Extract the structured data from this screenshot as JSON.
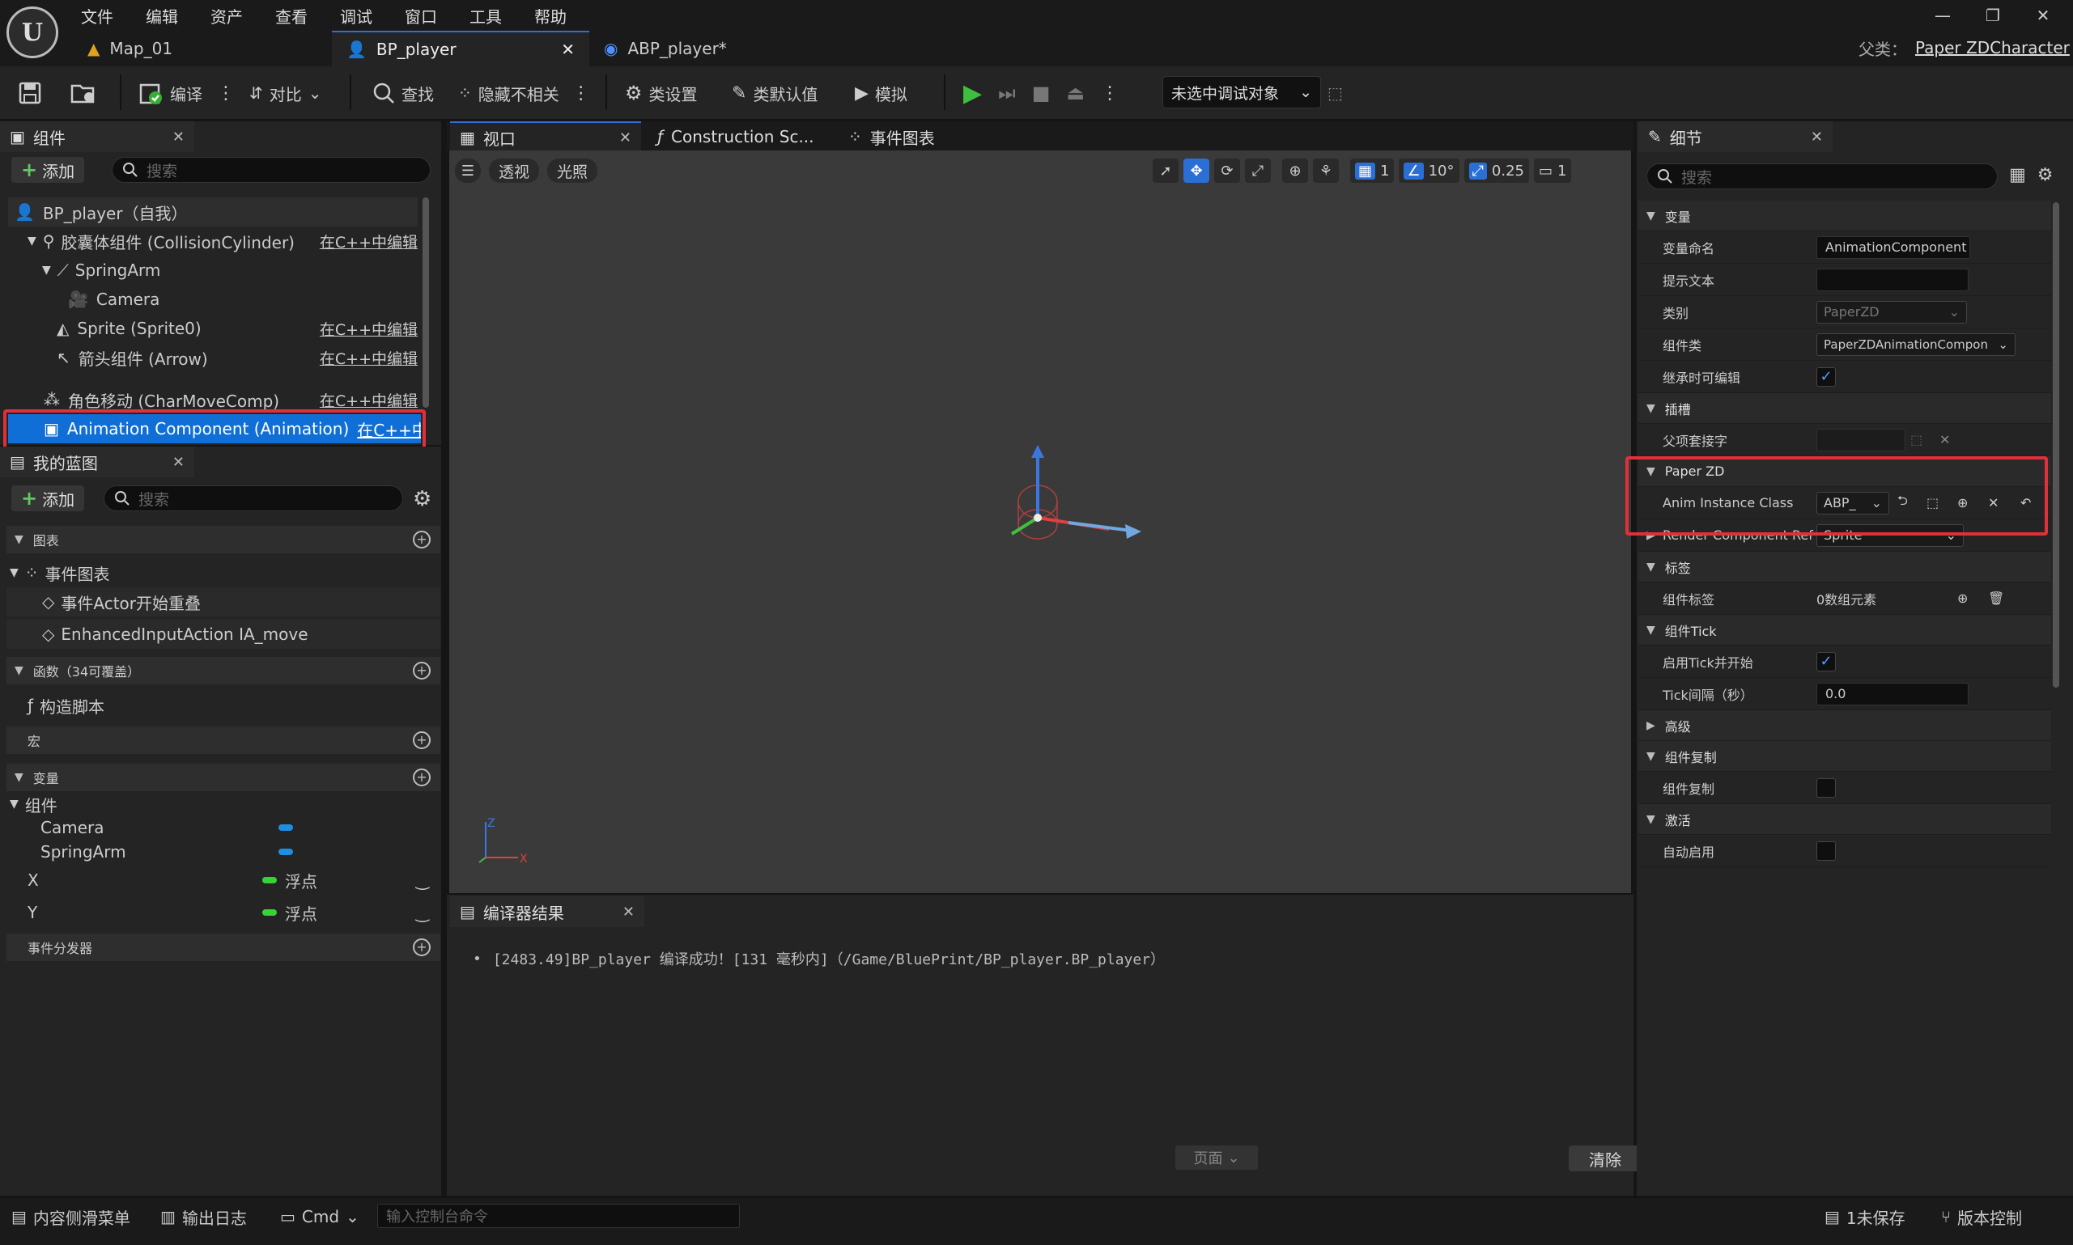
{
  "menu": [
    "文件",
    "编辑",
    "资产",
    "查看",
    "调试",
    "窗口",
    "工具",
    "帮助"
  ],
  "doc_tabs": [
    {
      "label": "Map_01"
    },
    {
      "label": "BP_player"
    },
    {
      "label": "ABP_player*"
    }
  ],
  "parent_class": {
    "label": "父类：",
    "value": "Paper ZDCharacter"
  },
  "toolbar": {
    "compile": "编译",
    "diff": "对比",
    "find": "查找",
    "hide_unrelated": "隐藏不相关",
    "class_settings": "类设置",
    "class_defaults": "类默认值",
    "simulate": "模拟",
    "debug_target": "未选中调试对象"
  },
  "components_panel": {
    "title": "组件",
    "add": "添加",
    "search_placeholder": "搜索",
    "root": "BP_player（自我）",
    "edit_in_cpp": "在C++中编辑",
    "items": [
      {
        "label": "胶囊体组件 (CollisionCylinder)",
        "cpp": true
      },
      {
        "label": "SpringArm",
        "cpp": false
      },
      {
        "label": "Camera",
        "cpp": false
      },
      {
        "label": "Sprite (Sprite0)",
        "cpp": true
      },
      {
        "label": "箭头组件 (Arrow)",
        "cpp": true
      },
      {
        "label": "角色移动 (CharMoveComp)",
        "cpp": true
      },
      {
        "label": "Animation Component (Animation)",
        "cpp": true
      }
    ]
  },
  "my_blueprint": {
    "title": "我的蓝图",
    "add": "添加",
    "search_placeholder": "搜索",
    "graphs": "图表",
    "event_graph": "事件图表",
    "events": [
      "事件Actor开始重叠",
      "EnhancedInputAction IA_move"
    ],
    "functions": "函数（34可覆盖）",
    "construction_script": "构造脚本",
    "macros": "宏",
    "variables": "变量",
    "components_group": "组件",
    "component_vars": [
      "Camera",
      "SpringArm"
    ],
    "float_vars": [
      {
        "name": "X",
        "type": "浮点"
      },
      {
        "name": "Y",
        "type": "浮点"
      }
    ],
    "event_dispatchers": "事件分发器"
  },
  "center_tabs": [
    "视口",
    "Construction Sc...",
    "事件图表"
  ],
  "viewport": {
    "perspective": "透视",
    "lit": "光照",
    "grid_value": "1",
    "angle_value": "10°",
    "scale_value": "0.25",
    "camera_speed": "1"
  },
  "compiler": {
    "title": "编译器结果",
    "message": "[2483.49]BP_player 编译成功！[131 毫秒内]（/Game/BluePrint/BP_player.BP_player）",
    "page": "页面",
    "clear": "清除"
  },
  "details": {
    "title": "细节",
    "search_placeholder": "搜索",
    "sections": {
      "variables": "变量",
      "sockets": "插槽",
      "paperzd": "Paper ZD",
      "tags": "标签",
      "tick": "组件Tick",
      "advanced": "高级",
      "replication": "组件复制",
      "activation": "激活"
    },
    "rows": {
      "var_name": {
        "label": "变量命名",
        "value": "AnimationComponent"
      },
      "tooltip": {
        "label": "提示文本",
        "value": ""
      },
      "category": {
        "label": "类别",
        "value": "PaperZD"
      },
      "component_class": {
        "label": "组件类",
        "value": "PaperZDAnimationCompon"
      },
      "editable_inherit": {
        "label": "继承时可编辑"
      },
      "parent_socket": {
        "label": "父项套接字"
      },
      "anim_instance": {
        "label": "Anim Instance Class",
        "value": "ABP_"
      },
      "render_ref": {
        "label": "Render Component Ref",
        "value": "Sprite"
      },
      "component_tags": {
        "label": "组件标签",
        "value": "0数组元素"
      },
      "start_tick": {
        "label": "启用Tick并开始"
      },
      "tick_interval": {
        "label": "Tick间隔（秒）",
        "value": "0.0"
      },
      "replicates": {
        "label": "组件复制"
      },
      "auto_activate": {
        "label": "自动启用"
      }
    }
  },
  "statusbar": {
    "content_drawer": "内容侧滑菜单",
    "output_log": "输出日志",
    "cmd": "Cmd",
    "console_placeholder": "输入控制台命令",
    "unsaved": "1未保存",
    "source_control": "版本控制"
  },
  "colors": {
    "accent_blue": "#2f6fd6",
    "selection": "#0f6fd6",
    "highlight_red": "#e0303a",
    "float_green": "#35d335",
    "component_blue": "#1e8fe0"
  }
}
